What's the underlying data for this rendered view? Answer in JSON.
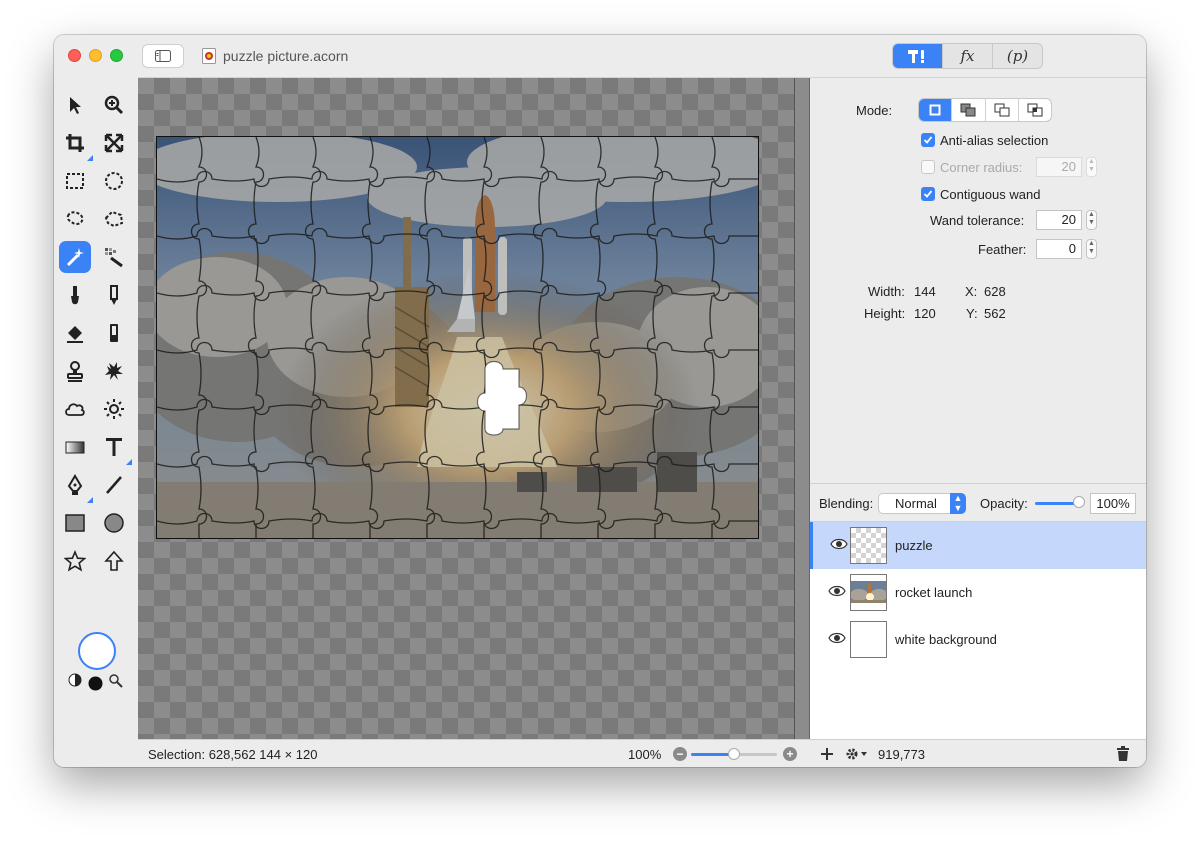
{
  "window": {
    "doc_title": "puzzle picture.acorn",
    "top_segments": [
      "tools-icon",
      "fx",
      "(p)"
    ],
    "top_segment_labels": {
      "fx": "fx",
      "p": "(p)"
    }
  },
  "tools": [
    "select-arrow-icon",
    "zoom-icon",
    "crop-icon",
    "transform-icon",
    "rect-select-icon",
    "oval-select-icon",
    "lasso-icon",
    "polygon-lasso-icon",
    "magic-wand-icon",
    "brush-wand-icon",
    "brush-icon",
    "pencil-icon",
    "eraser-icon",
    "smudge-icon",
    "clone-stamp-icon",
    "healing-icon",
    "cloud-icon",
    "sun-icon",
    "gradient-icon",
    "text-icon",
    "pen-icon",
    "line-icon",
    "rectangle-icon",
    "circle-icon",
    "star-icon",
    "arrow-icon"
  ],
  "inspector": {
    "mode_label": "Mode:",
    "anti_alias_label": "Anti-alias selection",
    "corner_radius_label": "Corner radius:",
    "corner_radius_value": "20",
    "contiguous_label": "Contiguous wand",
    "wand_tolerance_label": "Wand tolerance:",
    "wand_tolerance_value": "20",
    "feather_label": "Feather:",
    "feather_value": "0",
    "width_label": "Width:",
    "width_value": "144",
    "height_label": "Height:",
    "height_value": "120",
    "x_label": "X:",
    "x_value": "628",
    "y_label": "Y:",
    "y_value": "562",
    "anti_alias_checked": true,
    "corner_radius_checked": false,
    "contiguous_checked": true
  },
  "layers_panel": {
    "blending_label": "Blending:",
    "blending_value": "Normal",
    "opacity_label": "Opacity:",
    "opacity_value": "100%",
    "layers": [
      {
        "name": "puzzle",
        "selected": true
      },
      {
        "name": "rocket launch",
        "selected": false
      },
      {
        "name": "white background",
        "selected": false
      }
    ],
    "footer_coords": "919,773"
  },
  "statusbar": {
    "selection_text": "Selection: 628,562 144 × 120",
    "zoom": "100%",
    "zoom_level": 0.5
  },
  "colors": {
    "accent": "#3b82f6"
  }
}
